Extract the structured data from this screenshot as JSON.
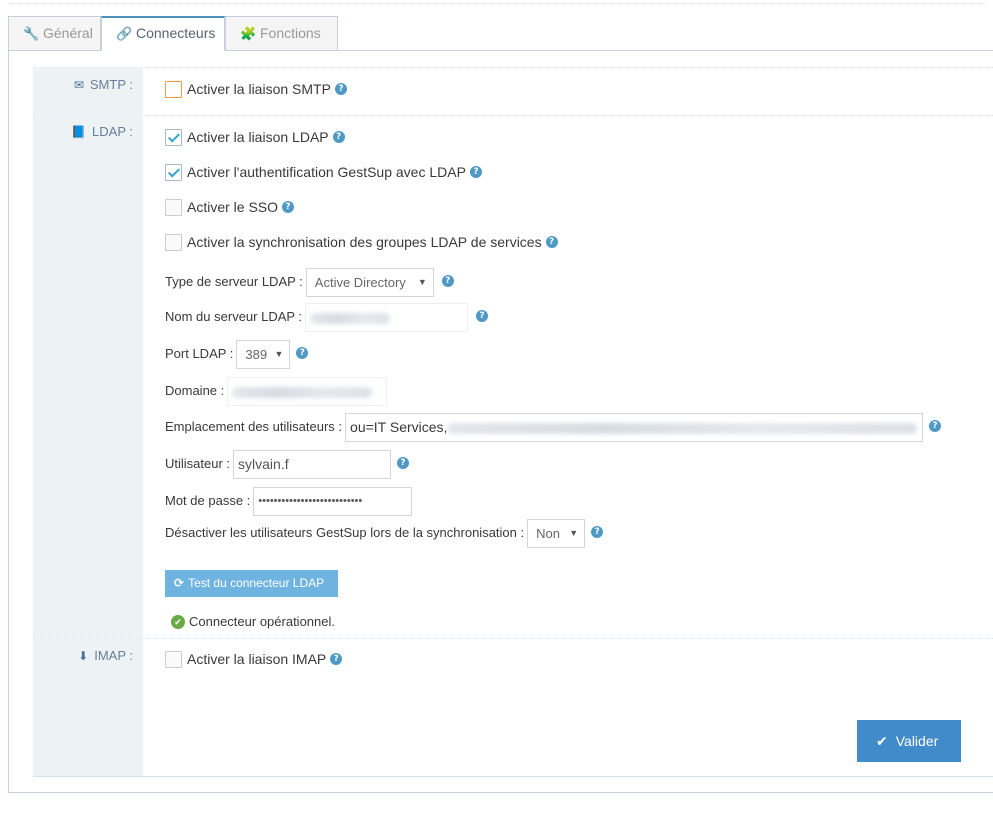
{
  "tabs": [
    {
      "label": "Général",
      "icon": "wrench-icon",
      "active": false
    },
    {
      "label": "Connecteurs",
      "icon": "link-icon",
      "active": true
    },
    {
      "label": "Fonctions",
      "icon": "puzzle-icon",
      "active": false
    }
  ],
  "smtp": {
    "label": "SMTP :",
    "enable_label": "Activer la liaison SMTP",
    "enable_checked": false
  },
  "ldap": {
    "label": "LDAP :",
    "enable_label": "Activer la liaison LDAP",
    "auth_label": "Activer l'authentification GestSup avec LDAP",
    "sso_label": "Activer le SSO",
    "sync_groups_label": "Activer la synchronisation des groupes LDAP de services",
    "server_type_label": "Type de serveur LDAP :",
    "server_type_value": "Active Directory",
    "server_name_label": "Nom du serveur LDAP :",
    "port_label": "Port LDAP :",
    "port_value": "389",
    "domain_label": "Domaine :",
    "users_location_label": "Emplacement des utilisateurs :",
    "users_location_value": "ou=IT Services,",
    "user_label": "Utilisateur :",
    "user_value": "sylvain.f",
    "password_label": "Mot de passe :",
    "password_value": "•••••••••••••••••••••••••••",
    "disable_users_label": "Désactiver les utilisateurs GestSup lors de la synchronisation :",
    "disable_users_value": "Non",
    "test_button": "Test du connecteur LDAP",
    "status_text": "Connecteur opérationnel."
  },
  "imap": {
    "label": "IMAP :",
    "enable_label": "Activer la liaison IMAP"
  },
  "submit_label": "Valider",
  "colors": {
    "primary": "#428bca",
    "info": "#6fb3e0",
    "success": "#69aa46",
    "label_bg": "#edf3f4"
  }
}
